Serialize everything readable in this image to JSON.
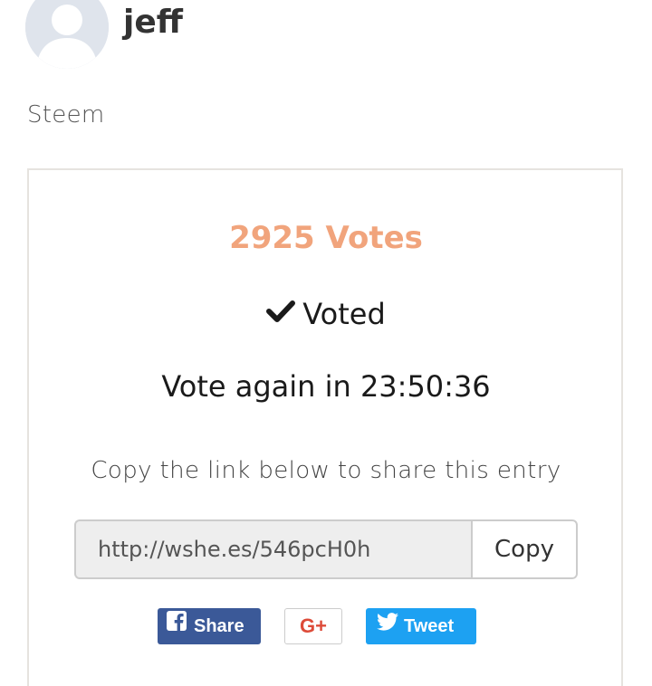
{
  "profile": {
    "username": "jeff",
    "category": "Steem",
    "avatar_icon": "default-user-avatar"
  },
  "vote_card": {
    "votes_text": "2925 Votes",
    "status_icon": "checkmark-icon",
    "status_label": "Voted",
    "countdown_text": "Vote again in 23:50:36",
    "share_prompt": "Copy the link below to share this entry",
    "share_link": "http://wshe.es/546pcH0h",
    "copy_label": "Copy"
  },
  "social": {
    "facebook_label": "Share",
    "googleplus_label": "G+",
    "twitter_label": "Tweet"
  },
  "colors": {
    "votes_accent": "#f1a47c",
    "facebook": "#3b5998",
    "googleplus": "#dd4b39",
    "twitter": "#1da1f2"
  }
}
